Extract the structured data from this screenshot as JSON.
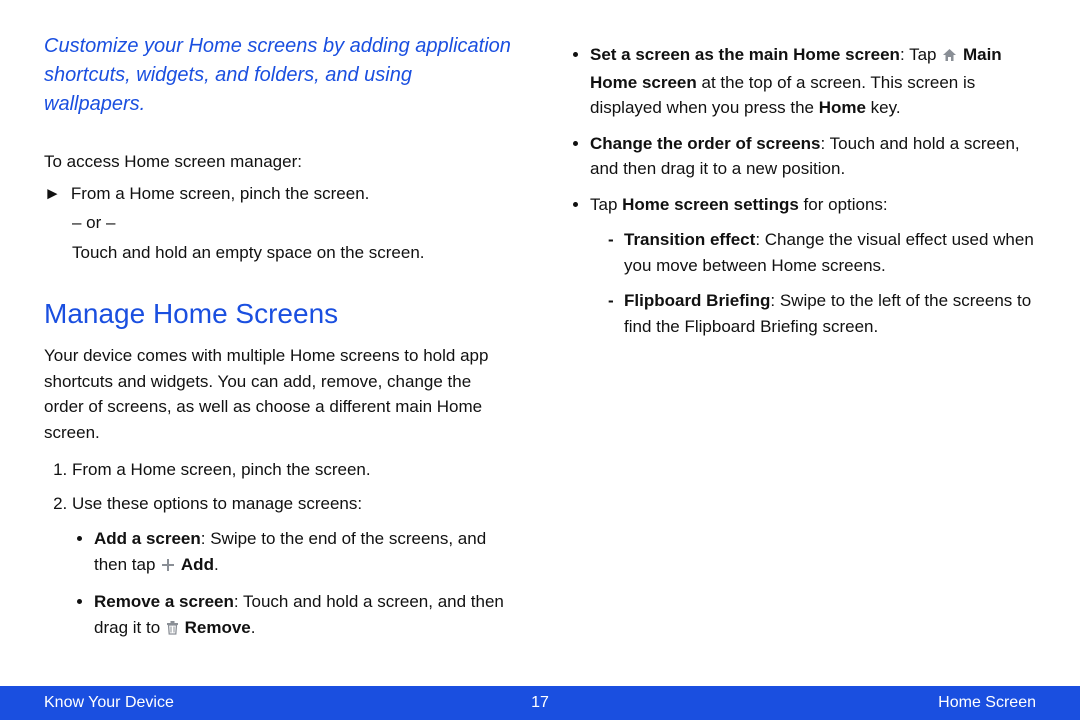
{
  "intro": "Customize your Home screens by adding application shortcuts, widgets, and folders, and using wallpapers.",
  "access": {
    "lead": "To access Home screen manager:",
    "step": "From a Home screen, pinch the screen.",
    "or": "– or –",
    "alt": "Touch and hold an empty space on the screen."
  },
  "section": {
    "title": "Manage Home Screens",
    "para": "Your device comes with multiple Home screens to hold app shortcuts and widgets. You can add, remove, change the order of screens, as well as choose a different main Home screen.",
    "steps": {
      "s1": "From a Home screen, pinch the screen.",
      "s2": "Use these options to manage screens:"
    },
    "opts": {
      "add": {
        "label": "Add a screen",
        "before": ": Swipe to the end of the screens, and then tap ",
        "iconword": "Add",
        "after": "."
      },
      "remove": {
        "label": "Remove a screen",
        "before": ": Touch and hold a screen, and then drag it to ",
        "iconword": "Remove",
        "after": "."
      }
    }
  },
  "right": {
    "setmain": {
      "label": "Set a screen as the main Home screen",
      "mid1": ": Tap ",
      "iconword": "Main Home screen",
      "mid2": " at the top of a screen. This screen is displayed when you press the ",
      "homekey": "Home",
      "tail": " key."
    },
    "order": {
      "label": "Change the order of screens",
      "text": ": Touch and hold a screen, and then drag it to a new position."
    },
    "settings": {
      "lead1": "Tap ",
      "bold": "Home screen settings",
      "lead2": " for options:",
      "transition": {
        "label": "Transition effect",
        "text": ": Change the visual effect used when you move between Home screens."
      },
      "flipboard": {
        "label": "Flipboard Briefing",
        "text": ": Swipe to the left of the screens to find the Flipboard Briefing screen."
      }
    }
  },
  "footer": {
    "left": "Know Your Device",
    "page": "17",
    "right": "Home Screen"
  },
  "glyphs": {
    "play": "►"
  }
}
